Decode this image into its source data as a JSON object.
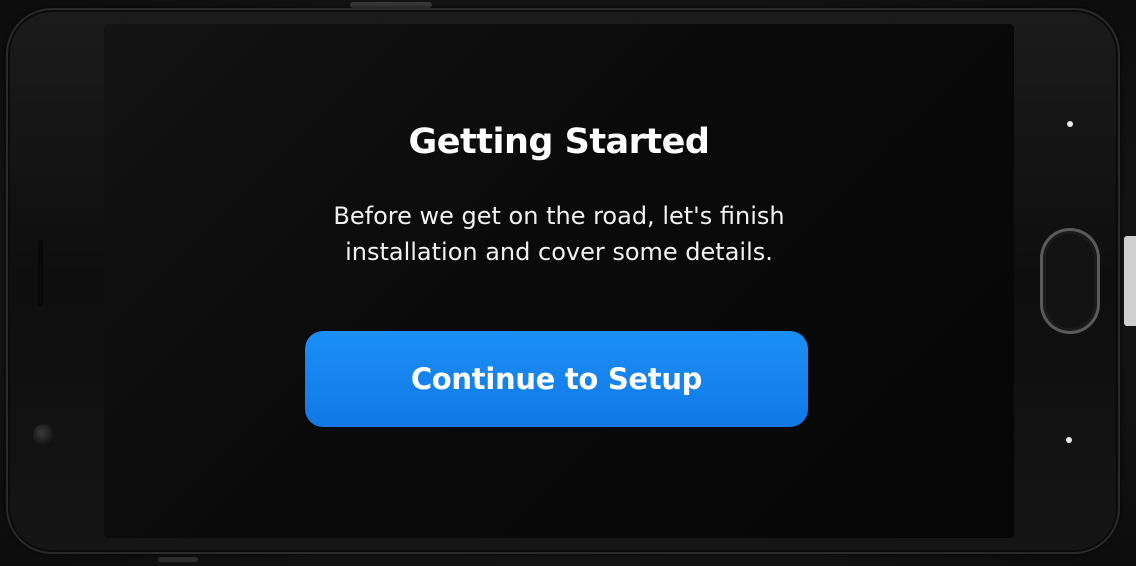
{
  "screen": {
    "title": "Getting Started",
    "description_lines": [
      "Before we get on the road, let's finish",
      "installation and cover some details."
    ],
    "primary_button_label": "Continue to Setup"
  },
  "colors": {
    "background": "#0a0a0a",
    "text": "#ffffff",
    "button": "#1585ee"
  }
}
